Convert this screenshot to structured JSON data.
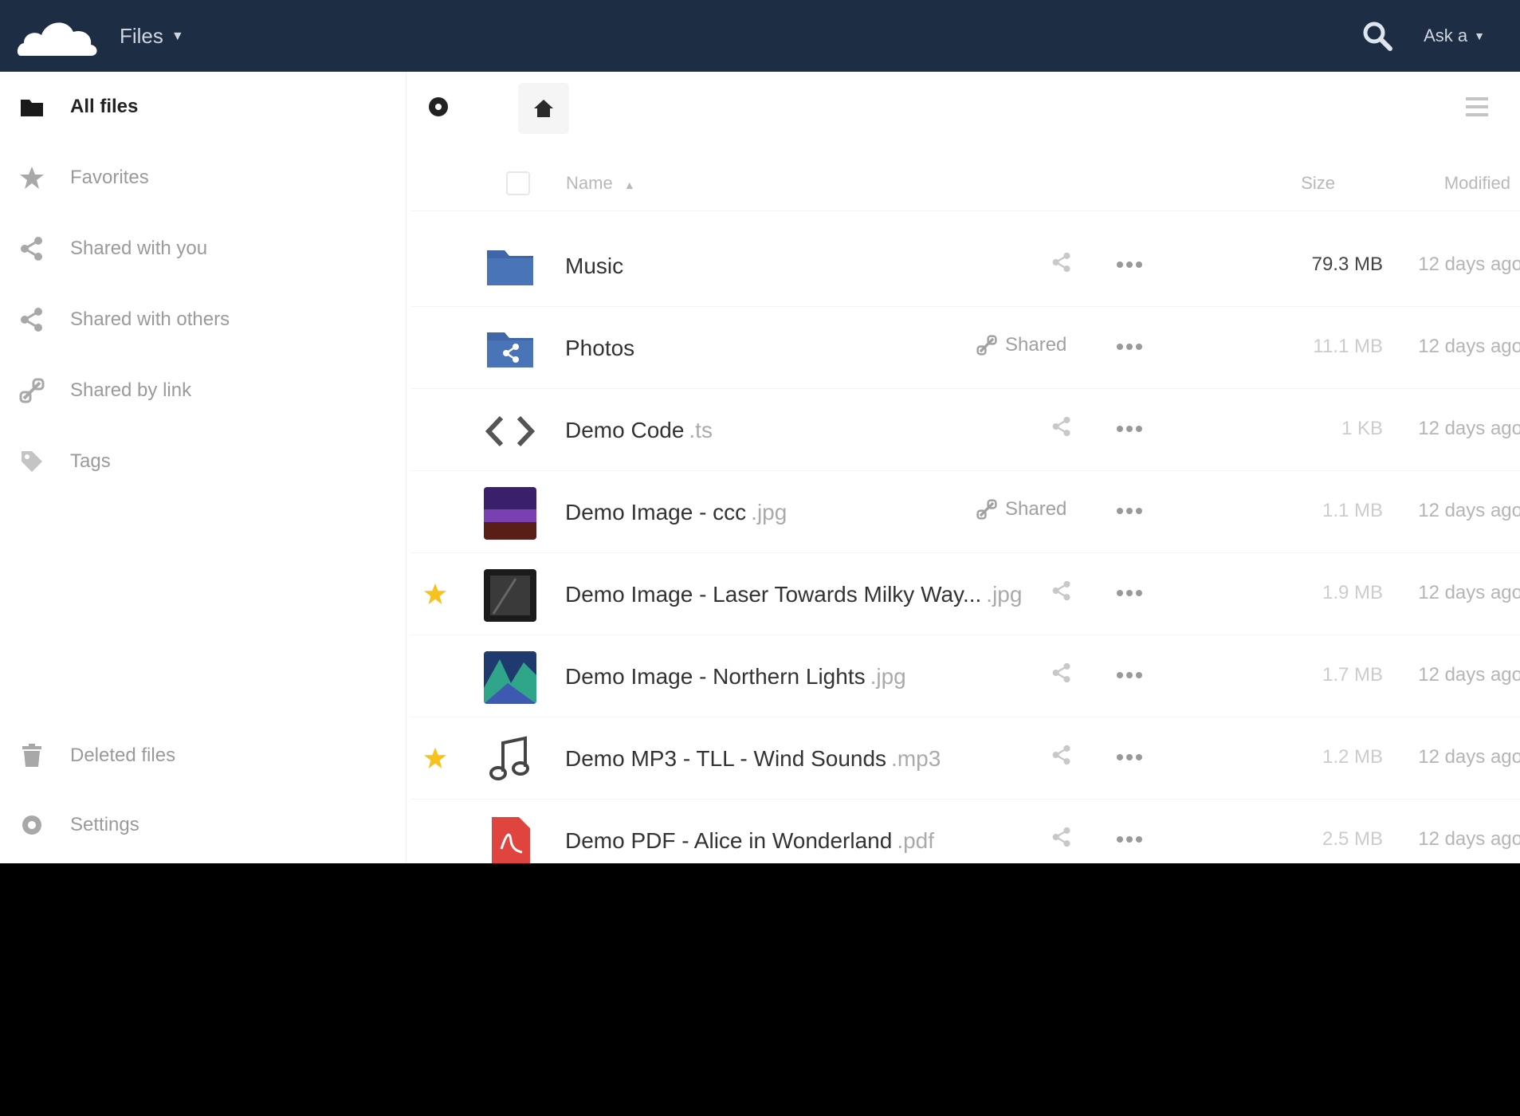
{
  "app": {
    "menu_label": "Files",
    "user_label": "Ask a"
  },
  "colors": {
    "header_bg": "#1d2d44",
    "folder_blue": "#3f67a8",
    "favorite_yellow": "#f7c21d",
    "pdf_red": "#e0443f"
  },
  "sidebar": {
    "items": [
      {
        "label": "All files",
        "icon": "folder-icon",
        "active": true
      },
      {
        "label": "Favorites",
        "icon": "star-icon"
      },
      {
        "label": "Shared with you",
        "icon": "share-icon"
      },
      {
        "label": "Shared with others",
        "icon": "share-icon"
      },
      {
        "label": "Shared by link",
        "icon": "link-icon"
      },
      {
        "label": "Tags",
        "icon": "tag-icon"
      }
    ],
    "footer_items": [
      {
        "label": "Deleted files",
        "icon": "trash-icon"
      },
      {
        "label": "Settings",
        "icon": "gear-icon"
      }
    ]
  },
  "table": {
    "columns": {
      "name": "Name",
      "size": "Size",
      "modified": "Modified"
    },
    "rows": [
      {
        "name": "Music",
        "ext": "",
        "favorite": false,
        "share": "",
        "size": "79.3 MB",
        "modified": "12 days ago",
        "thumb": "folder"
      },
      {
        "name": "Photos",
        "ext": "",
        "favorite": false,
        "share": "Shared",
        "size": "11.1 MB",
        "modified": "12 days ago",
        "thumb": "folder-shared"
      },
      {
        "name": "Demo Code",
        "ext": ".ts",
        "favorite": false,
        "share": "",
        "size": "1 KB",
        "modified": "12 days ago",
        "thumb": "code"
      },
      {
        "name": "Demo Image - ccc",
        "ext": ".jpg",
        "favorite": false,
        "share": "Shared",
        "size": "1.1 MB",
        "modified": "12 days ago",
        "thumb": "image-purple"
      },
      {
        "name": "Demo Image - Laser Towards Milky Way...",
        "ext": ".jpg",
        "favorite": true,
        "share": "",
        "size": "1.9 MB",
        "modified": "12 days ago",
        "thumb": "image-dark"
      },
      {
        "name": "Demo Image - Northern Lights",
        "ext": ".jpg",
        "favorite": false,
        "share": "",
        "size": "1.7 MB",
        "modified": "12 days ago",
        "thumb": "image-aurora"
      },
      {
        "name": "Demo MP3 - TLL - Wind Sounds",
        "ext": ".mp3",
        "favorite": true,
        "share": "",
        "size": "1.2 MB",
        "modified": "12 days ago",
        "thumb": "audio"
      },
      {
        "name": "Demo PDF - Alice in Wonderland",
        "ext": ".pdf",
        "favorite": false,
        "share": "",
        "size": "2.5 MB",
        "modified": "12 days ago",
        "thumb": "pdf"
      }
    ]
  }
}
